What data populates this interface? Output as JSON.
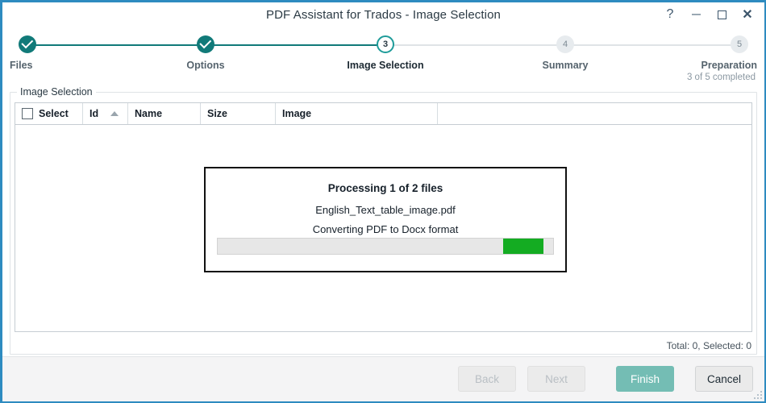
{
  "window": {
    "title": "PDF Assistant for Trados - Image Selection",
    "controls": {
      "help": "?",
      "minimize": "minimize",
      "maximize": "maximize",
      "close": "✕"
    }
  },
  "stepper": {
    "steps": [
      {
        "number": "1",
        "label": "Files",
        "state": "done"
      },
      {
        "number": "2",
        "label": "Options",
        "state": "done"
      },
      {
        "number": "3",
        "label": "Image Selection",
        "state": "current"
      },
      {
        "number": "4",
        "label": "Summary",
        "state": "todo"
      },
      {
        "number": "5",
        "label": "Preparation",
        "state": "todo"
      }
    ],
    "completed_text": "3 of 5 completed",
    "accent_color": "#117a79",
    "inactive_color": "#e7ebee"
  },
  "groupbox": {
    "title": "Image Selection"
  },
  "table": {
    "columns": [
      {
        "key": "select",
        "label": "Select"
      },
      {
        "key": "id",
        "label": "Id",
        "sort": "ascending"
      },
      {
        "key": "name",
        "label": "Name"
      },
      {
        "key": "size",
        "label": "Size"
      },
      {
        "key": "image",
        "label": "Image"
      }
    ],
    "rows": [],
    "status": "Total: 0, Selected: 0"
  },
  "progress_dialog": {
    "title": "Processing 1 of 2 files",
    "file_name": "English_Text_table_image.pdf",
    "status": "Converting PDF to Docx format",
    "bar": {
      "style": "marquee",
      "chunk_left_percent": 85,
      "chunk_width_percent": 12,
      "fill_color": "#14ac22",
      "track_color": "#e7e7e7"
    }
  },
  "footer": {
    "buttons": [
      {
        "key": "back",
        "label": "Back",
        "state": "disabled"
      },
      {
        "key": "next",
        "label": "Next",
        "state": "disabled"
      },
      {
        "key": "finish",
        "label": "Finish",
        "state": "primary"
      },
      {
        "key": "cancel",
        "label": "Cancel",
        "state": "normal"
      }
    ],
    "primary_color": "#74bdb4"
  }
}
